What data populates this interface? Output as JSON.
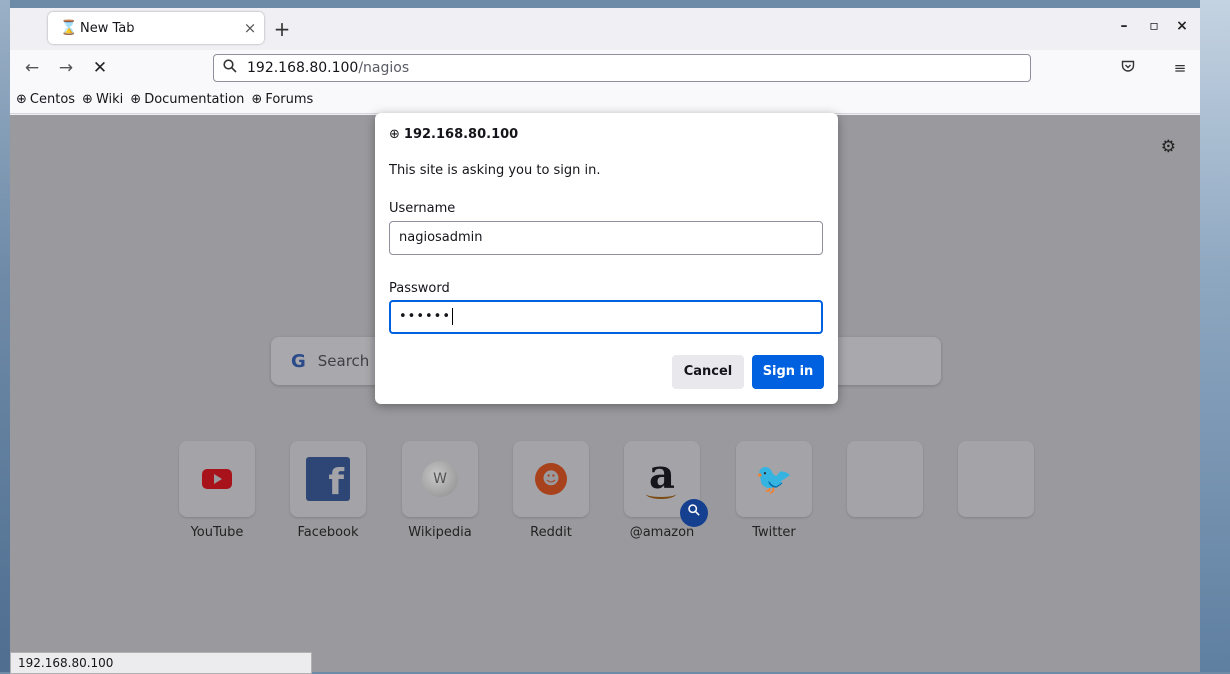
{
  "tab": {
    "title": "New Tab",
    "icon": "hourglass-icon"
  },
  "urlbar": {
    "host": "192.168.80.100",
    "path": "/nagios"
  },
  "bookmarks": [
    "Centos",
    "Wiki",
    "Documentation",
    "Forums"
  ],
  "newtab": {
    "search_placeholder": "Search",
    "sites": [
      {
        "label": "YouTube"
      },
      {
        "label": "Facebook"
      },
      {
        "label": "Wikipedia"
      },
      {
        "label": "Reddit"
      },
      {
        "label": "@amazon"
      },
      {
        "label": "Twitter"
      }
    ]
  },
  "status_text": "192.168.80.100",
  "auth_dialog": {
    "host": "192.168.80.100",
    "message": "This site is asking you to sign in.",
    "username_label": "Username",
    "username_value": "nagiosadmin",
    "password_label": "Password",
    "password_mask": "••••••",
    "cancel_label": "Cancel",
    "signin_label": "Sign in"
  },
  "colors": {
    "accent": "#0061e0",
    "dim_overlay": "#9a9a9e"
  }
}
